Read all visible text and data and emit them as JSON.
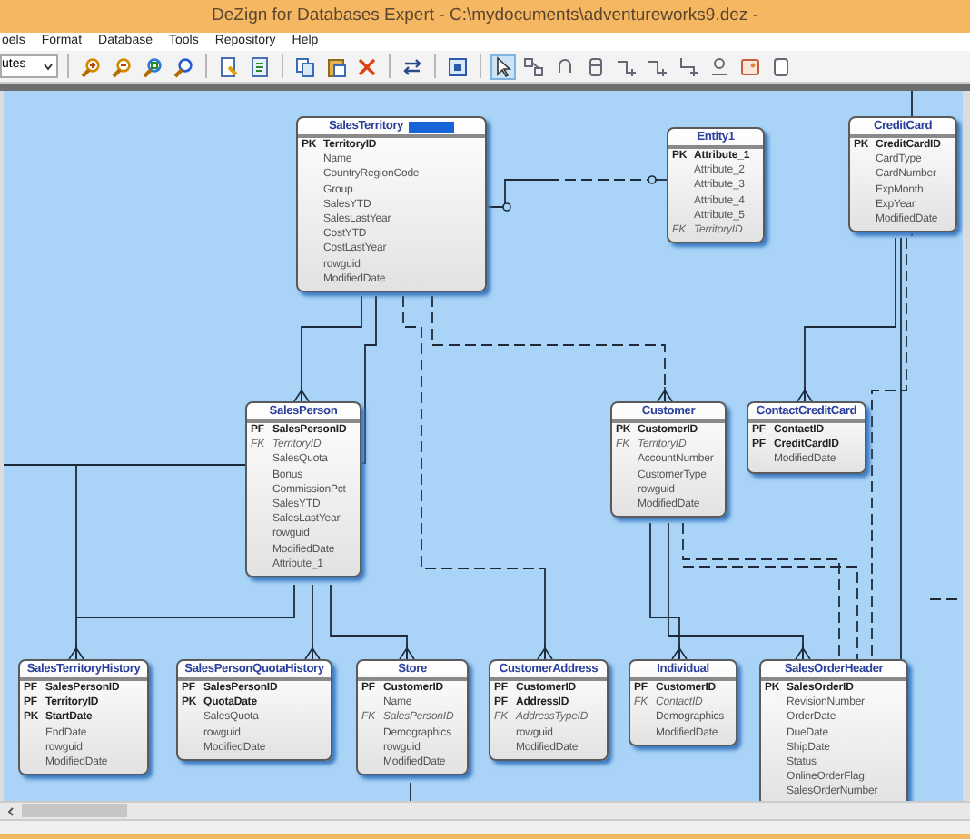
{
  "window": {
    "title": "DeZign for Databases Expert - C:\\mydocuments\\adventureworks9.dez -"
  },
  "menu": [
    "oels",
    "Format",
    "Database",
    "Tools",
    "Repository",
    "Help"
  ],
  "toolbar": {
    "dropdown": "utes",
    "groups": [
      [
        {
          "kind": "zoom-in",
          "selected": false
        },
        {
          "kind": "zoom-out",
          "selected": false
        },
        {
          "kind": "zoom-fit",
          "selected": false
        },
        {
          "kind": "zoom",
          "selected": false
        }
      ],
      [
        {
          "kind": "document",
          "selected": false
        },
        {
          "kind": "checklist",
          "selected": false
        }
      ],
      [
        {
          "kind": "copy",
          "selected": false
        },
        {
          "kind": "paste",
          "selected": false
        },
        {
          "kind": "delete",
          "selected": false
        }
      ],
      [
        {
          "kind": "swap",
          "selected": false
        }
      ],
      [
        {
          "kind": "frame",
          "selected": false
        }
      ],
      [
        {
          "kind": "pointer",
          "selected": true
        },
        {
          "kind": "entity-pair",
          "selected": false
        },
        {
          "kind": "loop",
          "selected": false
        },
        {
          "kind": "table",
          "selected": false
        },
        {
          "kind": "step",
          "selected": false
        },
        {
          "kind": "step",
          "selected": false
        },
        {
          "kind": "step-down",
          "selected": false
        },
        {
          "kind": "person",
          "selected": false
        },
        {
          "kind": "image",
          "selected": false
        },
        {
          "kind": "page",
          "selected": false
        }
      ]
    ]
  },
  "entities": [
    {
      "name": "SalesTerritory",
      "selected": true,
      "rows": [
        {
          "key": "PK",
          "name": "TerritoryID",
          "kind": "primary"
        },
        {
          "name": "Name",
          "kind": "attribute"
        },
        {
          "name": "CountryRegionCode",
          "kind": "attribute"
        },
        {
          "name": "Group",
          "kind": "attribute"
        },
        {
          "name": "SalesYTD",
          "kind": "attribute"
        },
        {
          "name": "SalesLastYear",
          "kind": "attribute"
        },
        {
          "name": "CostYTD",
          "kind": "attribute"
        },
        {
          "name": "CostLastYear",
          "kind": "attribute"
        },
        {
          "name": "rowguid",
          "kind": "attribute"
        },
        {
          "name": "ModifiedDate",
          "kind": "attribute"
        }
      ]
    },
    {
      "name": "Entity1",
      "selected": false,
      "rows": [
        {
          "key": "PK",
          "name": "Attribute_1",
          "kind": "primary"
        },
        {
          "name": "Attribute_2",
          "kind": "attribute"
        },
        {
          "name": "Attribute_3",
          "kind": "attribute"
        },
        {
          "name": "Attribute_4",
          "kind": "attribute"
        },
        {
          "name": "Attribute_5",
          "kind": "attribute"
        },
        {
          "key": "FK",
          "name": "TerritoryID",
          "kind": "foreign"
        }
      ]
    },
    {
      "name": "CreditCard",
      "selected": false,
      "rows": [
        {
          "key": "PK",
          "name": "CreditCardID",
          "kind": "primary"
        },
        {
          "name": "CardType",
          "kind": "attribute"
        },
        {
          "name": "CardNumber",
          "kind": "attribute"
        },
        {
          "name": "ExpMonth",
          "kind": "attribute"
        },
        {
          "name": "ExpYear",
          "kind": "attribute"
        },
        {
          "name": "ModifiedDate",
          "kind": "attribute"
        }
      ]
    },
    {
      "name": "SalesPerson",
      "selected": false,
      "rows": [
        {
          "key": "PF",
          "name": "SalesPersonID",
          "kind": "primary"
        },
        {
          "key": "FK",
          "name": "TerritoryID",
          "kind": "foreign"
        },
        {
          "name": "SalesQuota",
          "kind": "attribute"
        },
        {
          "name": "Bonus",
          "kind": "attribute"
        },
        {
          "name": "CommissionPct",
          "kind": "attribute"
        },
        {
          "name": "SalesYTD",
          "kind": "attribute"
        },
        {
          "name": "SalesLastYear",
          "kind": "attribute"
        },
        {
          "name": "rowguid",
          "kind": "attribute"
        },
        {
          "name": "ModifiedDate",
          "kind": "attribute"
        },
        {
          "name": "Attribute_1",
          "kind": "attribute"
        }
      ]
    },
    {
      "name": "Customer",
      "selected": false,
      "rows": [
        {
          "key": "PK",
          "name": "CustomerID",
          "kind": "primary"
        },
        {
          "key": "FK",
          "name": "TerritoryID",
          "kind": "foreign"
        },
        {
          "name": "AccountNumber",
          "kind": "attribute"
        },
        {
          "name": "CustomerType",
          "kind": "attribute"
        },
        {
          "name": "rowguid",
          "kind": "attribute"
        },
        {
          "name": "ModifiedDate",
          "kind": "attribute"
        }
      ]
    },
    {
      "name": "ContactCreditCard",
      "selected": false,
      "rows": [
        {
          "key": "PF",
          "name": "ContactID",
          "kind": "primary"
        },
        {
          "key": "PF",
          "name": "CreditCardID",
          "kind": "primary"
        },
        {
          "name": "ModifiedDate",
          "kind": "attribute"
        }
      ]
    },
    {
      "name": "SalesTerritoryHistory",
      "selected": false,
      "rows": [
        {
          "key": "PF",
          "name": "SalesPersonID",
          "kind": "primary"
        },
        {
          "key": "PF",
          "name": "TerritoryID",
          "kind": "primary"
        },
        {
          "key": "PK",
          "name": "StartDate",
          "kind": "primary"
        },
        {
          "name": "EndDate",
          "kind": "attribute"
        },
        {
          "name": "rowguid",
          "kind": "attribute"
        },
        {
          "name": "ModifiedDate",
          "kind": "attribute"
        }
      ]
    },
    {
      "name": "SalesPersonQuotaHistory",
      "selected": false,
      "rows": [
        {
          "key": "PF",
          "name": "SalesPersonID",
          "kind": "primary"
        },
        {
          "key": "PK",
          "name": "QuotaDate",
          "kind": "primary"
        },
        {
          "name": "SalesQuota",
          "kind": "attribute"
        },
        {
          "name": "rowguid",
          "kind": "attribute"
        },
        {
          "name": "ModifiedDate",
          "kind": "attribute"
        }
      ]
    },
    {
      "name": "Store",
      "selected": false,
      "rows": [
        {
          "key": "PF",
          "name": "CustomerID",
          "kind": "primary"
        },
        {
          "name": "Name",
          "kind": "attribute"
        },
        {
          "key": "FK",
          "name": "SalesPersonID",
          "kind": "foreign"
        },
        {
          "name": "Demographics",
          "kind": "attribute"
        },
        {
          "name": "rowguid",
          "kind": "attribute"
        },
        {
          "name": "ModifiedDate",
          "kind": "attribute"
        }
      ]
    },
    {
      "name": "CustomerAddress",
      "selected": false,
      "rows": [
        {
          "key": "PF",
          "name": "CustomerID",
          "kind": "primary"
        },
        {
          "key": "PF",
          "name": "AddressID",
          "kind": "primary"
        },
        {
          "key": "FK",
          "name": "AddressTypeID",
          "kind": "foreign"
        },
        {
          "name": "rowguid",
          "kind": "attribute"
        },
        {
          "name": "ModifiedDate",
          "kind": "attribute"
        }
      ]
    },
    {
      "name": "Individual",
      "selected": false,
      "rows": [
        {
          "key": "PF",
          "name": "CustomerID",
          "kind": "primary"
        },
        {
          "key": "FK",
          "name": "ContactID",
          "kind": "foreign"
        },
        {
          "name": "Demographics",
          "kind": "attribute"
        },
        {
          "name": "ModifiedDate",
          "kind": "attribute"
        }
      ]
    },
    {
      "name": "SalesOrderHeader",
      "selected": false,
      "rows": [
        {
          "key": "PK",
          "name": "SalesOrderID",
          "kind": "primary"
        },
        {
          "name": "RevisionNumber",
          "kind": "attribute"
        },
        {
          "name": "OrderDate",
          "kind": "attribute"
        },
        {
          "name": "DueDate",
          "kind": "attribute"
        },
        {
          "name": "ShipDate",
          "kind": "attribute"
        },
        {
          "name": "Status",
          "kind": "attribute"
        },
        {
          "name": "OnlineOrderFlag",
          "kind": "attribute"
        },
        {
          "name": "SalesOrderNumber",
          "kind": "attribute"
        }
      ]
    }
  ]
}
